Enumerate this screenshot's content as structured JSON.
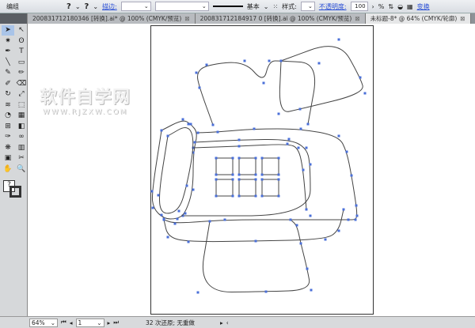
{
  "control_bar": {
    "group_label": "编组",
    "fill_icon": "?",
    "stroke_icon": "?",
    "stroke_label": "描边:",
    "stroke_profile": "基本",
    "style_label": "样式:",
    "opacity_label": "不透明度:",
    "opacity_value": "100",
    "opacity_unit": "%",
    "transform_label": "变换"
  },
  "tabs": [
    {
      "label": "200831712180346 [转换].ai* @ 100% (CMYK/预览)",
      "active": false
    },
    {
      "label": "200831712184917 0 [转换].ai @ 100% (CMYK/预览)",
      "active": false
    },
    {
      "label": "未标题-8* @ 64% (CMYK/轮廓)",
      "active": true
    }
  ],
  "tools": [
    "selection",
    "direct-selection",
    "magic-wand",
    "lasso",
    "pen",
    "type",
    "line",
    "rectangle",
    "paintbrush",
    "pencil",
    "blob-brush",
    "eraser",
    "rotate",
    "scale",
    "warp",
    "free-transform",
    "shape-builder",
    "perspective",
    "mesh",
    "gradient",
    "eyedropper",
    "blend",
    "symbol-sprayer",
    "graph",
    "artboard",
    "slice",
    "hand",
    "zoom"
  ],
  "tool_glyphs": [
    "➤",
    "↖",
    "✷",
    "ʘ",
    "✒",
    "T",
    "╲",
    "▭",
    "✎",
    "✏",
    "✐",
    "⌫",
    "↻",
    "⤢",
    "≋",
    "⬚",
    "◔",
    "▦",
    "⊞",
    "◧",
    "✑",
    "∞",
    "❋",
    "▥",
    "▣",
    "✂",
    "✋",
    "🔍"
  ],
  "watermark": {
    "title": "软件自学网",
    "url": "WWW.RJZXW.COM"
  },
  "status": {
    "zoom": "64%",
    "page": "1",
    "message": "32 次还原; 无重做"
  },
  "colors": {
    "anchor": "#4a6fd8",
    "path": "#444444"
  }
}
